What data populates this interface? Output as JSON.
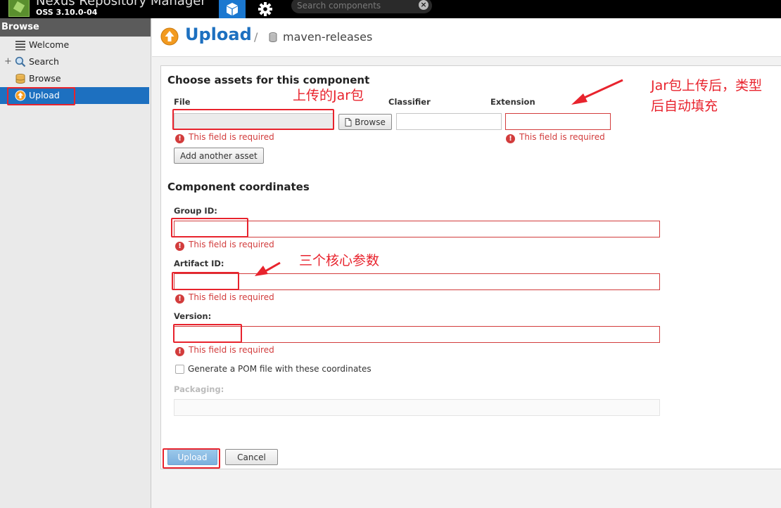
{
  "app": {
    "name": "Nexus Repository Manager",
    "version": "OSS 3.10.0-04",
    "search_placeholder": "Search components"
  },
  "sidebar": {
    "header": "Browse",
    "items": [
      {
        "label": "Welcome",
        "icon": "welcome-icon"
      },
      {
        "label": "Search",
        "icon": "search-icon"
      },
      {
        "label": "Browse",
        "icon": "browse-icon"
      },
      {
        "label": "Upload",
        "icon": "upload-icon",
        "active": true
      }
    ]
  },
  "header": {
    "title": "Upload",
    "separator": "/",
    "repository": "maven-releases"
  },
  "assets": {
    "section_title": "Choose assets for this component",
    "file_label": "File",
    "classifier_label": "Classifier",
    "extension_label": "Extension",
    "browse_button": "Browse",
    "add_another_button": "Add another asset",
    "file_error": "This field is required",
    "extension_error": "This field is required"
  },
  "coordinates": {
    "section_title": "Component coordinates",
    "group_id_label": "Group ID:",
    "group_id_error": "This field is required",
    "artifact_id_label": "Artifact ID:",
    "artifact_id_error": "This field is required",
    "version_label": "Version:",
    "version_error": "This field is required",
    "generate_pom_label": "Generate a POM file with these coordinates",
    "packaging_label": "Packaging:"
  },
  "actions": {
    "upload_button": "Upload",
    "cancel_button": "Cancel"
  },
  "annotations": {
    "jar_upload_note": "上传的Jar包",
    "autofill_note_line1": "Jar包上传后，类型",
    "autofill_note_line2": "后自动填充",
    "core_params_note": "三个核心参数"
  },
  "colors": {
    "accent": "#1d70c0",
    "error": "#d23c3c",
    "annotation": "#e8232d",
    "topbar": "#000000"
  }
}
